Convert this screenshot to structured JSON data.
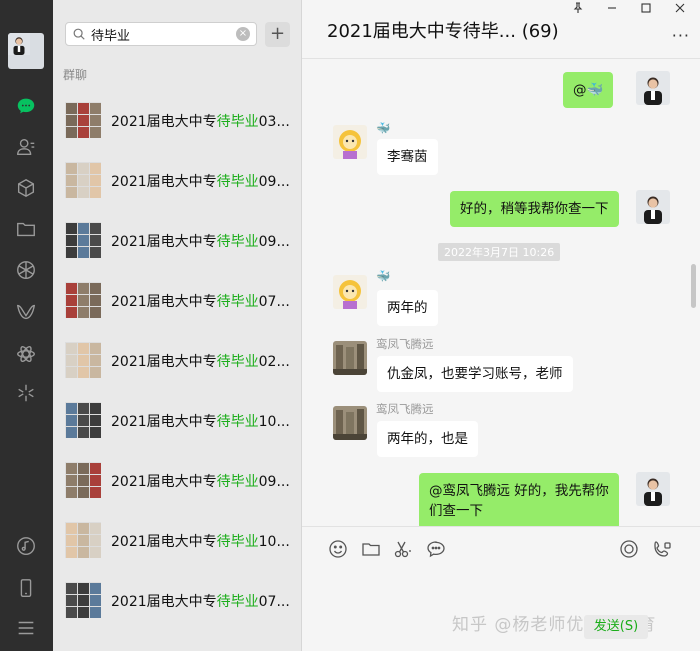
{
  "nav": {
    "items": [
      "chat-icon",
      "contacts-icon",
      "favorites-icon",
      "files-icon",
      "moments-icon",
      "channels-icon",
      "mini-programs-icon",
      "search-icon",
      "music-icon",
      "phone-icon",
      "menu-icon"
    ]
  },
  "search": {
    "value": "待毕业",
    "clear_label": "×",
    "add_label": "+"
  },
  "section_label": "群聊",
  "chat_list": [
    {
      "prefix": "2021届电大中专",
      "highlight": "待毕业",
      "suffix": "03..."
    },
    {
      "prefix": "2021届电大中专",
      "highlight": "待毕业",
      "suffix": "09..."
    },
    {
      "prefix": "2021届电大中专",
      "highlight": "待毕业",
      "suffix": "09..."
    },
    {
      "prefix": "2021届电大中专",
      "highlight": "待毕业",
      "suffix": "07..."
    },
    {
      "prefix": "2021届电大中专",
      "highlight": "待毕业",
      "suffix": "02..."
    },
    {
      "prefix": "2021届电大中专",
      "highlight": "待毕业",
      "suffix": "10..."
    },
    {
      "prefix": "2021届电大中专",
      "highlight": "待毕业",
      "suffix": "09..."
    },
    {
      "prefix": "2021届电大中专",
      "highlight": "待毕业",
      "suffix": "10..."
    },
    {
      "prefix": "2021届电大中专",
      "highlight": "待毕业",
      "suffix": "07..."
    }
  ],
  "chat": {
    "title": "2021届电大中专待毕... (69)",
    "window_buttons": [
      "pin-icon",
      "minimize-icon",
      "maximize-icon",
      "close-icon"
    ],
    "more_label": "···",
    "messages": [
      {
        "side": "out",
        "text": "@🐳"
      },
      {
        "side": "in",
        "sender": "🐳",
        "text": "李骞茵"
      },
      {
        "side": "out",
        "text": "好的，稍等我帮你查一下"
      },
      {
        "timestamp": "2022年3月7日 10:26"
      },
      {
        "side": "in",
        "sender": "🐳",
        "text": "两年的"
      },
      {
        "side": "in",
        "sender": "鸾凤飞腾远",
        "text": "仇金凤，也要学习账号，老师"
      },
      {
        "side": "in",
        "sender": "鸾凤飞腾远",
        "text": "两年的，也是"
      },
      {
        "side": "out",
        "text": "@鸾凤飞腾远 好的，我先帮你\n们查一下"
      }
    ],
    "tools": [
      "emoji-icon",
      "folder-icon",
      "scissors-icon",
      "chat-bubble-icon",
      "live-icon",
      "video-call-icon"
    ],
    "send_label": "发送(S)",
    "watermark": "知乎 @杨老师优思学教育"
  }
}
